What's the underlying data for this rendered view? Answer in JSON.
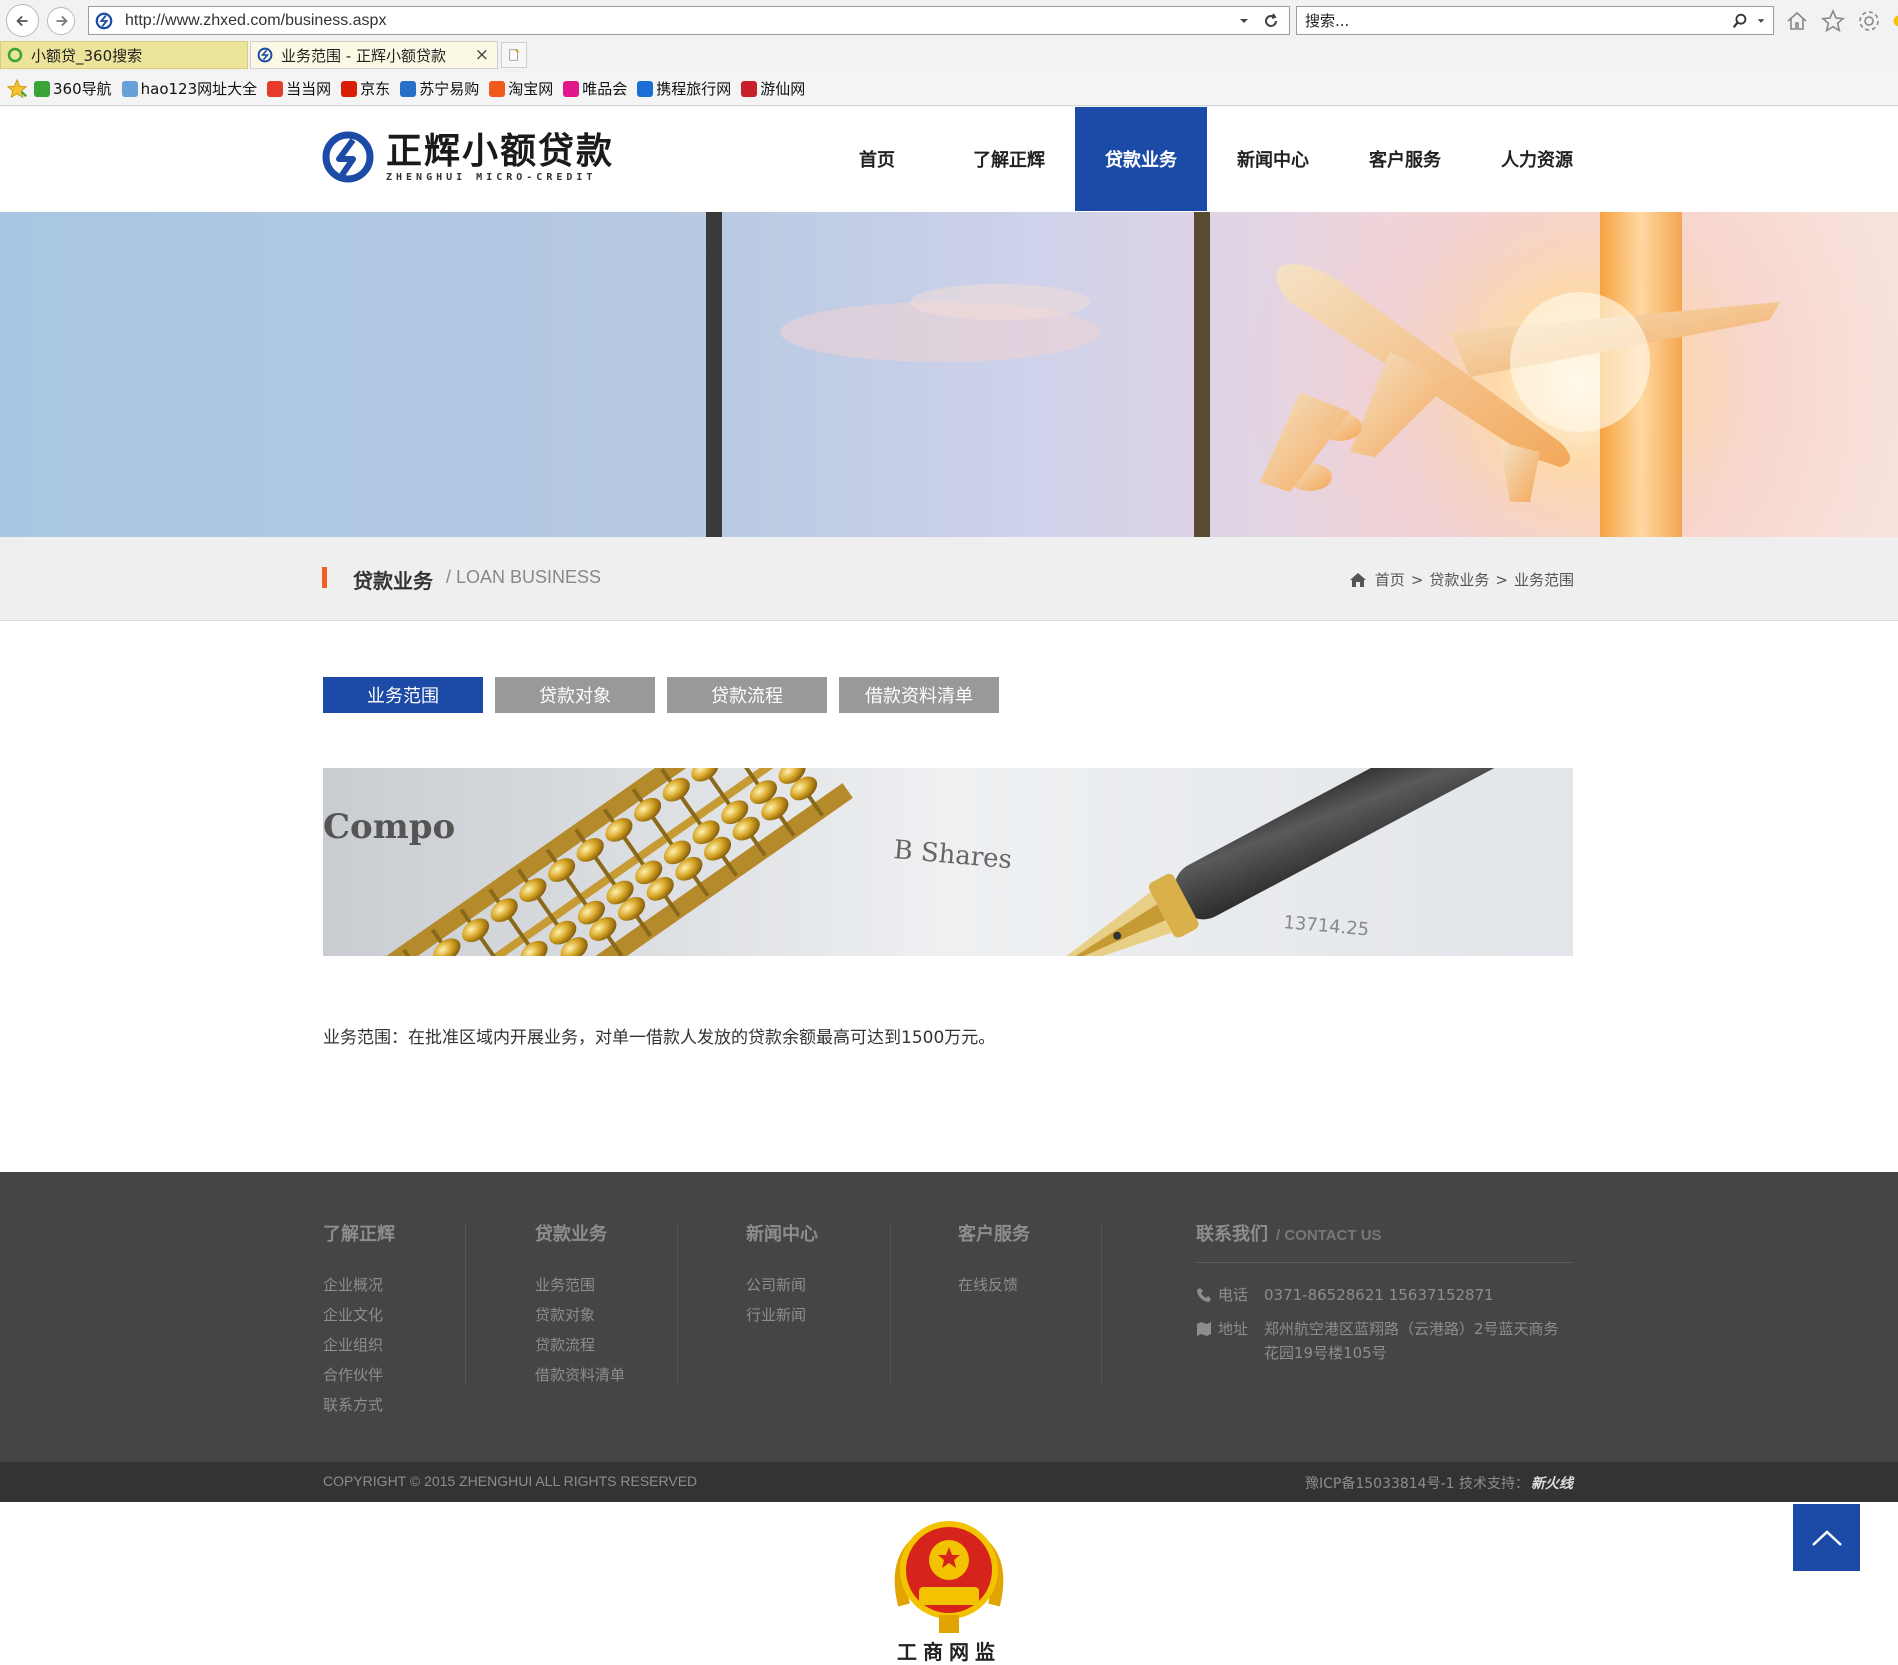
{
  "browser": {
    "url": "http://www.zhxed.com/business.aspx",
    "search_placeholder": "搜索...",
    "tabs": [
      {
        "title": "小额贷_360搜索"
      },
      {
        "title": "业务范围 - 正辉小额贷款"
      }
    ],
    "close_glyph": "×",
    "favorites": [
      {
        "label": "360导航",
        "color": "#3aa33a"
      },
      {
        "label": "hao123网址大全",
        "color": "#6aa0d8"
      },
      {
        "label": "当当网",
        "color": "#e63a2a"
      },
      {
        "label": "京东",
        "color": "#d81e06"
      },
      {
        "label": "苏宁易购",
        "color": "#2a6fc7"
      },
      {
        "label": "淘宝网",
        "color": "#f05a1a"
      },
      {
        "label": "唯品会",
        "color": "#e0178a"
      },
      {
        "label": "携程旅行网",
        "color": "#1d6fd8"
      },
      {
        "label": "游仙网",
        "color": "#c8202a"
      }
    ]
  },
  "site": {
    "logo_cn": "正辉小额贷款",
    "logo_en": "ZHENGHUI MICRO-CREDIT",
    "brand_color": "#1c4aa7",
    "accent_color": "#f0601f",
    "nav": [
      {
        "label": "首页",
        "active": false
      },
      {
        "label": "了解正辉",
        "active": false
      },
      {
        "label": "贷款业务",
        "active": true
      },
      {
        "label": "新闻中心",
        "active": false
      },
      {
        "label": "客户服务",
        "active": false
      },
      {
        "label": "人力资源",
        "active": false
      }
    ]
  },
  "section": {
    "title_cn": "贷款业务",
    "title_en": "/ LOAN BUSINESS",
    "breadcrumb": [
      "首页",
      "贷款业务",
      "业务范围"
    ],
    "breadcrumb_sep": ">"
  },
  "subtabs": [
    {
      "label": "业务范围",
      "active": true
    },
    {
      "label": "贷款对象",
      "active": false
    },
    {
      "label": "贷款流程",
      "active": false
    },
    {
      "label": "借款资料清单",
      "active": false
    }
  ],
  "content": {
    "image_caption": "B Shares",
    "image_num": "13714.25",
    "image_word": "Compo",
    "text": "业务范围：在批准区域内开展业务，对单一借款人发放的贷款余额最高可达到1500万元。"
  },
  "footer": {
    "columns": [
      {
        "title": "了解正辉",
        "links": [
          "企业概况",
          "企业文化",
          "企业组织",
          "合作伙伴",
          "联系方式"
        ]
      },
      {
        "title": "贷款业务",
        "links": [
          "业务范围",
          "贷款对象",
          "贷款流程",
          "借款资料清单"
        ]
      },
      {
        "title": "新闻中心",
        "links": [
          "公司新闻",
          "行业新闻"
        ]
      },
      {
        "title": "客户服务",
        "links": [
          "在线反馈"
        ]
      }
    ],
    "contact": {
      "title_cn": "联系我们",
      "title_en": "/ CONTACT US",
      "phone_label": "电话",
      "phone": "0371-86528621 15637152871",
      "address_label": "地址",
      "address": "郑州航空港区蓝翔路（云港路）2号蓝天商务花园19号楼105号"
    },
    "copyright": "COPYRIGHT © 2015 ZHENGHUI ALL RIGHTS RESERVED",
    "icp": "豫ICP备15033814号-1 技术支持：",
    "tech_brand": "新火线"
  },
  "badge": {
    "label": "工商网监"
  }
}
